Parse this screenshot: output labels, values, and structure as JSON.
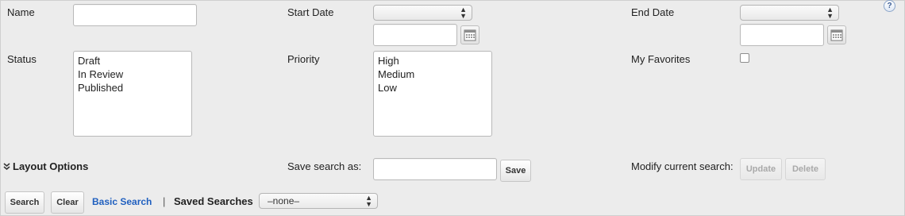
{
  "fields": {
    "name_label": "Name",
    "name_value": "",
    "start_date_label": "Start Date",
    "start_date_select": "",
    "start_date_value": "",
    "end_date_label": "End Date",
    "end_date_select": "",
    "end_date_value": "",
    "status_label": "Status",
    "status_options": [
      "Draft",
      "In Review",
      "Published"
    ],
    "priority_label": "Priority",
    "priority_options": [
      "High",
      "Medium",
      "Low"
    ],
    "favorites_label": "My Favorites",
    "favorites_checked": false
  },
  "layout_options": {
    "toggle_icon": "double-chevron-down-icon",
    "label": "Layout Options"
  },
  "save_search": {
    "label": "Save search as:",
    "value": "",
    "save_button": "Save"
  },
  "modify_search": {
    "label": "Modify current search:",
    "update_button": "Update",
    "delete_button": "Delete"
  },
  "footer": {
    "search_button": "Search",
    "clear_button": "Clear",
    "basic_search_link": "Basic Search",
    "separator": "|",
    "saved_searches_label": "Saved Searches",
    "saved_searches_value": "–none–"
  },
  "help": {
    "icon": "help-icon",
    "glyph": "?"
  },
  "colors": {
    "background": "#ececec",
    "link": "#1f5fbf"
  }
}
